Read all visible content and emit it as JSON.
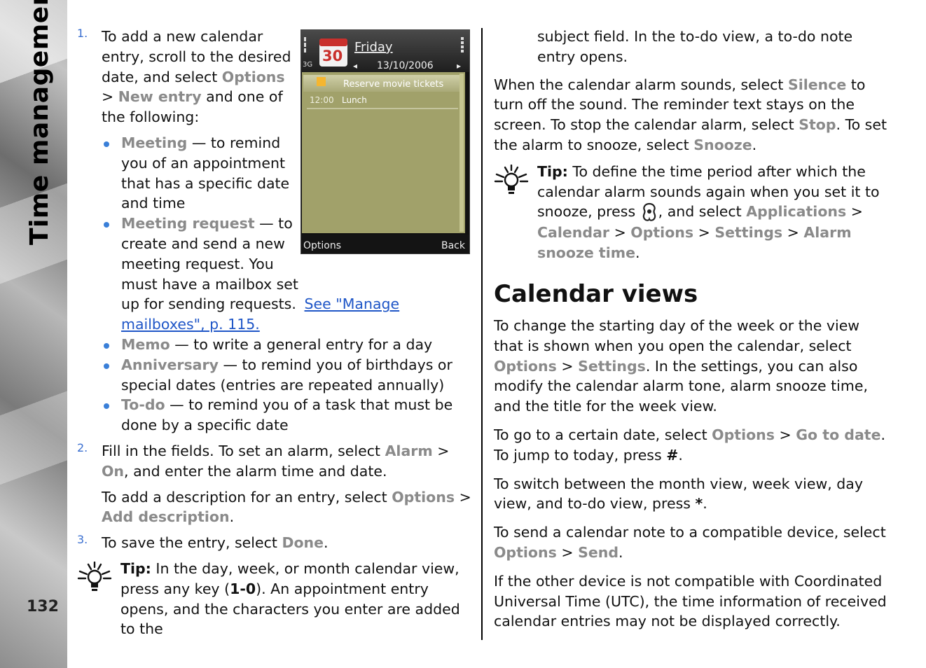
{
  "section_title": "Time management",
  "page_number": "132",
  "phone_screen": {
    "day": "Friday",
    "calendar_number": "30",
    "date": "13/10/2006",
    "network": "3G",
    "todo_item": "Reserve movie tickets",
    "entry_time": "12:00",
    "entry_text": "Lunch",
    "left_softkey": "Options",
    "right_softkey": "Back"
  },
  "step1": {
    "number": "1.",
    "text": "To add a new calendar entry, scroll to the desired date, and select",
    "opt_a": "Options",
    "sep": ">",
    "opt_b": "New entry",
    "text2": "and one of the following:"
  },
  "bullets": [
    {
      "term": "Meeting",
      "text": " — to remind you of an appointment that has a specific date and time"
    },
    {
      "term": "Meeting request",
      "text": " — to create and send a new meeting request. You must have a mailbox set up for sending requests. ",
      "link": "See \"Manage mailboxes\", p. 115."
    },
    {
      "term": "Memo",
      "text": " — to write a general entry for a day"
    },
    {
      "term": "Anniversary",
      "text": " — to remind you of birthdays or special dates (entries are repeated annually)"
    },
    {
      "term": "To-do",
      "text": " — to remind you of a task that must be done by a specific date"
    }
  ],
  "step2": {
    "number": "2.",
    "text": "Fill in the fields. To set an alarm, select",
    "opt_a": "Alarm",
    "sep": ">",
    "opt_b": "On",
    "text2": ", and enter the alarm time and date.",
    "desc_text": "To add a description for an entry, select",
    "desc_opt_a": "Options",
    "desc_opt_b": "Add description",
    "desc_end": "."
  },
  "step3": {
    "number": "3.",
    "text": "To save the entry, select",
    "opt": "Done",
    "end": "."
  },
  "tip1": {
    "label": "Tip:",
    "text": " In the day, week, or month calendar view, press any key (",
    "key": "1-0",
    "text2": "). An appointment entry opens, and the characters you enter are added to the"
  },
  "right": {
    "continued": "subject field. In the to-do view, a to-do note entry opens.",
    "alarm_p1": "When the calendar alarm sounds, select",
    "silence": "Silence",
    "alarm_p2": "to turn off the sound. The reminder text stays on the screen. To stop the calendar alarm, select",
    "stop": "Stop",
    "alarm_p3": ". To set the alarm to snooze, select",
    "snooze": "Snooze",
    "alarm_p4": ".",
    "tip_label": "Tip:",
    "tip_text": " To define the time period after which the calendar alarm sounds again when you set it to snooze, press",
    "tip_text2": ", and select",
    "tip_opt1": "Applications",
    "tip_opt2": "Calendar",
    "tip_opt3": "Options",
    "tip_opt4": "Settings",
    "tip_opt5": "Alarm snooze time",
    "tip_end": ".",
    "heading": "Calendar views",
    "p1_a": "To change the starting day of the week or the view that is shown when you open the calendar, select",
    "p1_opt1": "Options",
    "p1_opt2": "Settings",
    "p1_b": ". In the settings, you can also modify the calendar alarm tone, alarm snooze time, and the title for the week view.",
    "p2_a": "To go to a certain date, select",
    "p2_opt1": "Options",
    "p2_opt2": "Go to date",
    "p2_b": ". To jump to today, press",
    "p2_key": "#",
    "p2_c": ".",
    "p3_a": "To switch between the month view, week view, day view, and to-do view, press",
    "p3_key": "*",
    "p3_b": ".",
    "p4_a": "To send a calendar note to a compatible device, select",
    "p4_opt1": "Options",
    "p4_opt2": "Send",
    "p4_b": ".",
    "p5": "If the other device is not compatible with Coordinated Universal Time (UTC), the time information of received calendar entries may not be displayed correctly."
  }
}
